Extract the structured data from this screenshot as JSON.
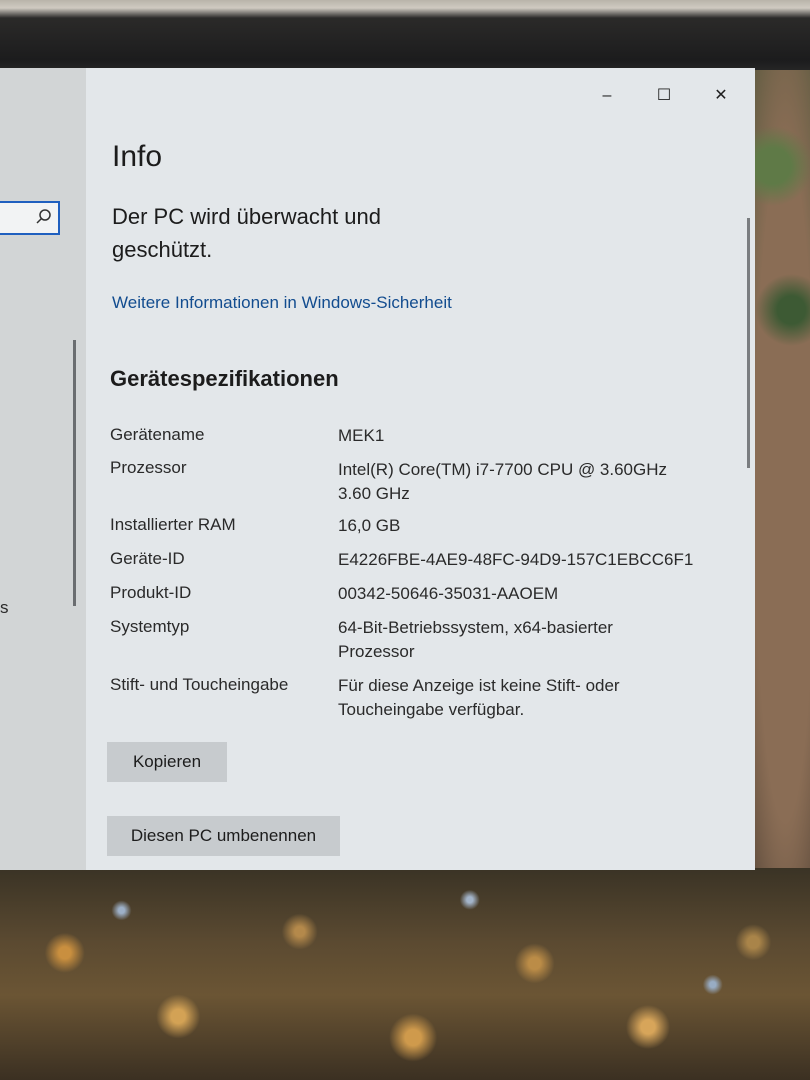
{
  "window": {
    "title_controls": {
      "minimize": "–",
      "maximize": "☐",
      "close": "✕"
    }
  },
  "sidebar": {
    "search_icon": "search-icon",
    "trailing_text": "s"
  },
  "page": {
    "title": "Info",
    "protection_status": "Der PC wird überwacht und geschützt.",
    "security_link": "Weitere Informationen in Windows-Sicherheit"
  },
  "specs": {
    "heading": "Gerätespezifikationen",
    "rows": [
      {
        "label": "Gerätename",
        "value": "MEK1"
      },
      {
        "label": "Prozessor",
        "value": "Intel(R) Core(TM) i7-7700 CPU @ 3.60GHz 3.60 GHz"
      },
      {
        "label": "Installierter RAM",
        "value": "16,0 GB"
      },
      {
        "label": "Geräte-ID",
        "value": "E4226FBE-4AE9-48FC-94D9-157C1EBCC6F1"
      },
      {
        "label": "Produkt-ID",
        "value": "00342-50646-35031-AAOEM"
      },
      {
        "label": "Systemtyp",
        "value": "64-Bit-Betriebssystem, x64-basierter Prozessor"
      },
      {
        "label": "Stift- und Toucheingabe",
        "value": "Für diese Anzeige ist keine Stift- oder Toucheingabe verfügbar."
      }
    ]
  },
  "buttons": {
    "copy": "Kopieren",
    "rename": "Diesen PC umbenennen"
  }
}
